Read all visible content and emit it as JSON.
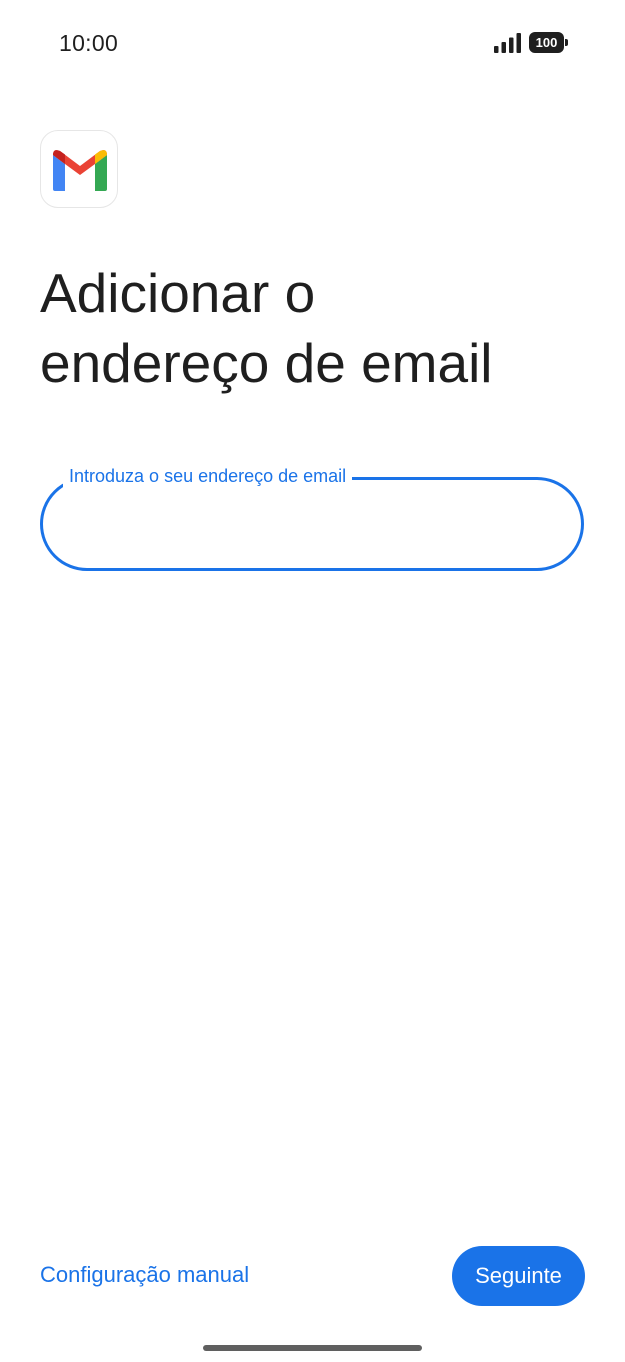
{
  "status_bar": {
    "time": "10:00",
    "battery_level": "100",
    "icons": [
      "signal-icon",
      "battery-icon"
    ]
  },
  "app": {
    "logo_icon": "gmail-logo-icon"
  },
  "page": {
    "title_line1": "Adicionar o",
    "title_line2": "endereço de email"
  },
  "email_field": {
    "label": "Introduza o seu endereço de email",
    "value": ""
  },
  "footer": {
    "manual_setup_label": "Configuração manual",
    "next_label": "Seguinte"
  },
  "colors": {
    "accent": "#1a73e8",
    "text": "#1f1f1f",
    "background": "#ffffff"
  }
}
